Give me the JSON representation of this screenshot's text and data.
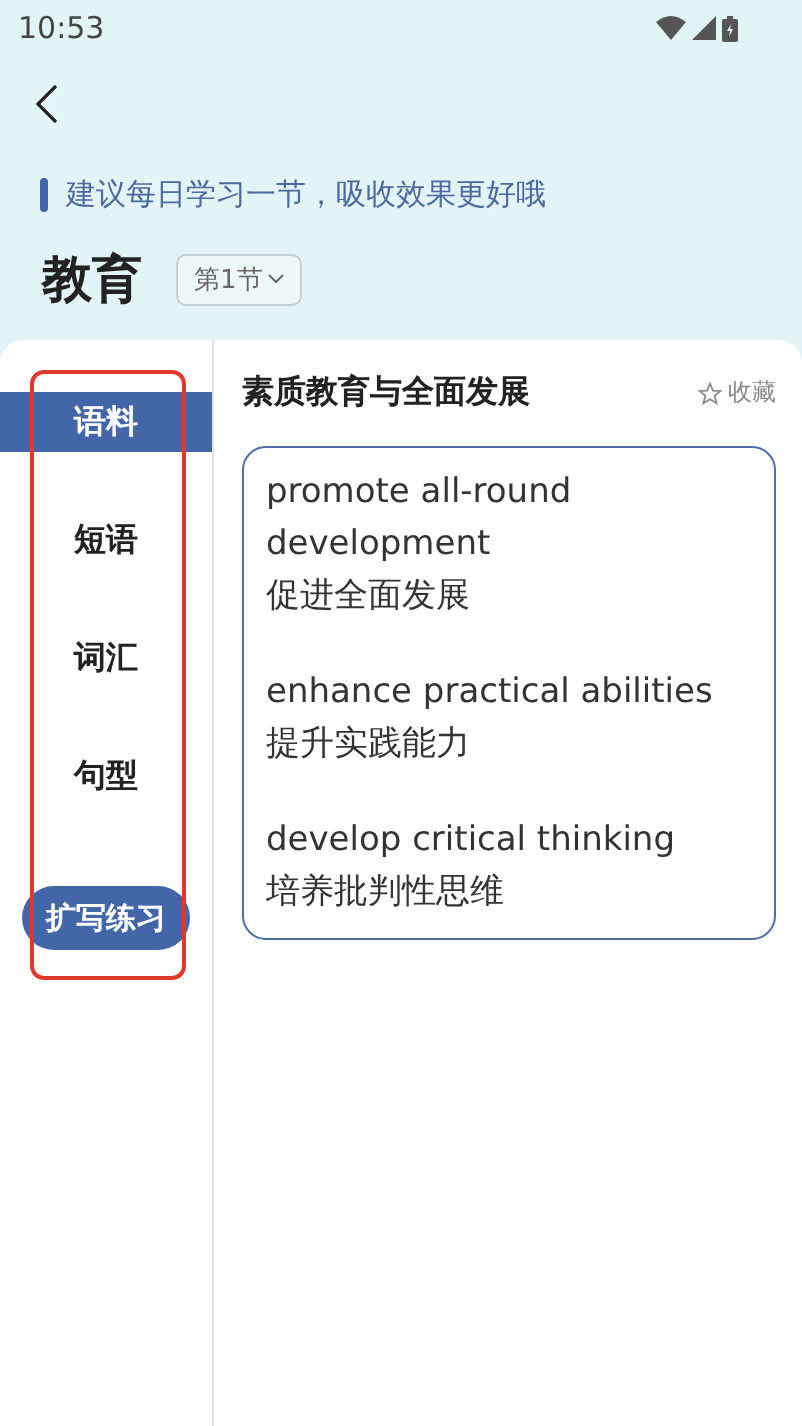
{
  "status_bar": {
    "time": "10:53"
  },
  "header": {
    "title": "教育",
    "tip": "建议每日学习一节，吸收效果更好哦",
    "section_dropdown": "第1节"
  },
  "sidebar": {
    "items": [
      {
        "label": "语料",
        "selected": true
      },
      {
        "label": "短语",
        "selected": false
      },
      {
        "label": "词汇",
        "selected": false
      },
      {
        "label": "句型",
        "selected": false
      }
    ],
    "action_button": "扩写练习",
    "highlighted": true
  },
  "content": {
    "title": "素质教育与全面发展",
    "favorite": "收藏",
    "phrases": [
      {
        "english": "promote all-round development",
        "chinese": "促进全面发展"
      },
      {
        "english": "enhance practical abilities",
        "chinese": "提升实践能力"
      },
      {
        "english": "develop critical thinking",
        "chinese": "培养批判性思维"
      }
    ]
  }
}
